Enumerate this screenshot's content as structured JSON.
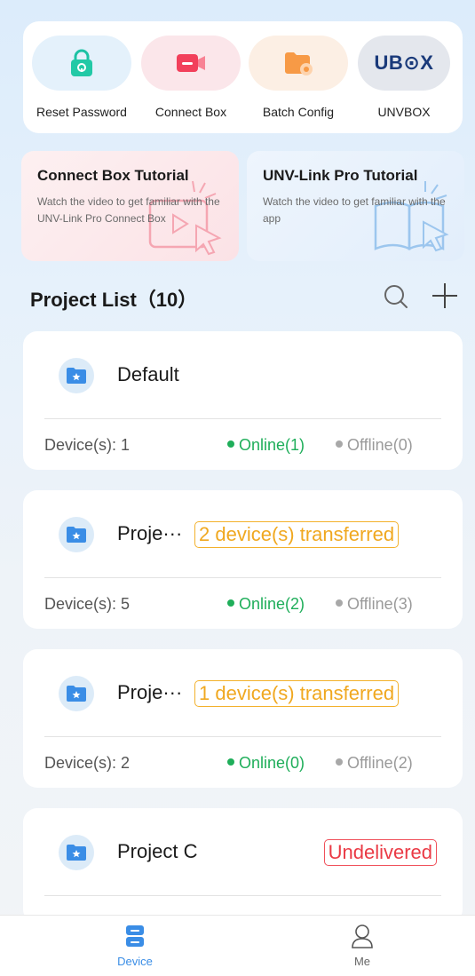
{
  "quick_actions": [
    {
      "label": "Reset Password",
      "icon": "lock-icon"
    },
    {
      "label": "Connect Box",
      "icon": "camera-box-icon"
    },
    {
      "label": "Batch Config",
      "icon": "folder-gear-icon"
    },
    {
      "label": "UNVBOX",
      "icon": "ubox-logo",
      "logo_text": "UB⊙X"
    }
  ],
  "tutorials": [
    {
      "title": "Connect Box Tutorial",
      "desc": "Watch the video to get familiar with the UNV-Link Pro Connect Box"
    },
    {
      "title": "UNV-Link Pro Tutorial",
      "desc": "Watch the video to get familiar with the app"
    }
  ],
  "project_list": {
    "title": "Project List（10）",
    "projects": [
      {
        "name": "Default",
        "badge": "",
        "devices": "Device(s): 1",
        "online": "Online(1)",
        "offline": "Offline(0)"
      },
      {
        "name": "Proje···",
        "badge": "2 device(s) transferred",
        "devices": "Device(s): 5",
        "online": "Online(2)",
        "offline": "Offline(3)"
      },
      {
        "name": "Proje···",
        "badge": "1 device(s) transferred",
        "devices": "Device(s): 2",
        "online": "Online(0)",
        "offline": "Offline(2)"
      },
      {
        "name": "Project C",
        "badge": "Undelivered",
        "devices": "",
        "online": "",
        "offline": ""
      }
    ]
  },
  "tabbar": {
    "device": "Device",
    "me": "Me"
  },
  "colors": {
    "accent": "#3a8de6",
    "online": "#1fae5a",
    "transferred": "#f0a820",
    "undelivered": "#ea3a45"
  }
}
